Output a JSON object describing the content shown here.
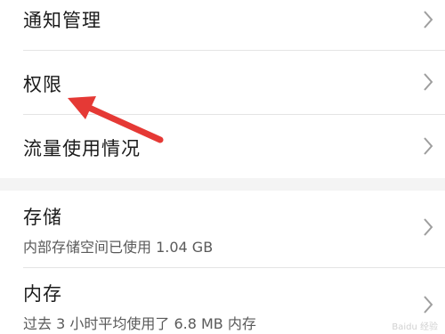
{
  "settings": {
    "items": [
      {
        "label": "通知管理"
      },
      {
        "label": "权限"
      },
      {
        "label": "流量使用情况"
      },
      {
        "label": "存储",
        "sub": "内部存储空间已使用 1.04 GB"
      },
      {
        "label": "内存",
        "sub": "过去 3 小时平均使用了 6.8 MB 内存"
      }
    ]
  },
  "watermark": {
    "text": "Baidu 经验"
  },
  "colors": {
    "arrow": "#e53935",
    "chevron": "#9e9e9e"
  }
}
